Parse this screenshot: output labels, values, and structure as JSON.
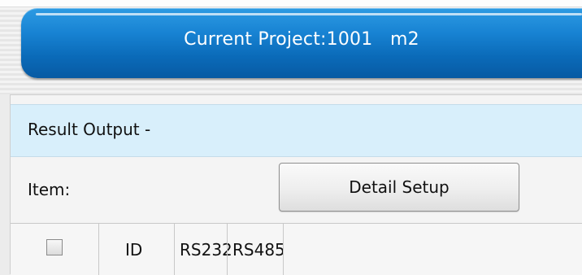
{
  "header": {
    "title": "Current Project:1001   m2"
  },
  "result_output": {
    "section_title": "Result Output -",
    "item_label": "Item:",
    "detail_setup_label": "Detail Setup"
  },
  "table": {
    "columns": [
      "ID",
      "RS232",
      "RS485"
    ],
    "select_all_checked": false
  }
}
